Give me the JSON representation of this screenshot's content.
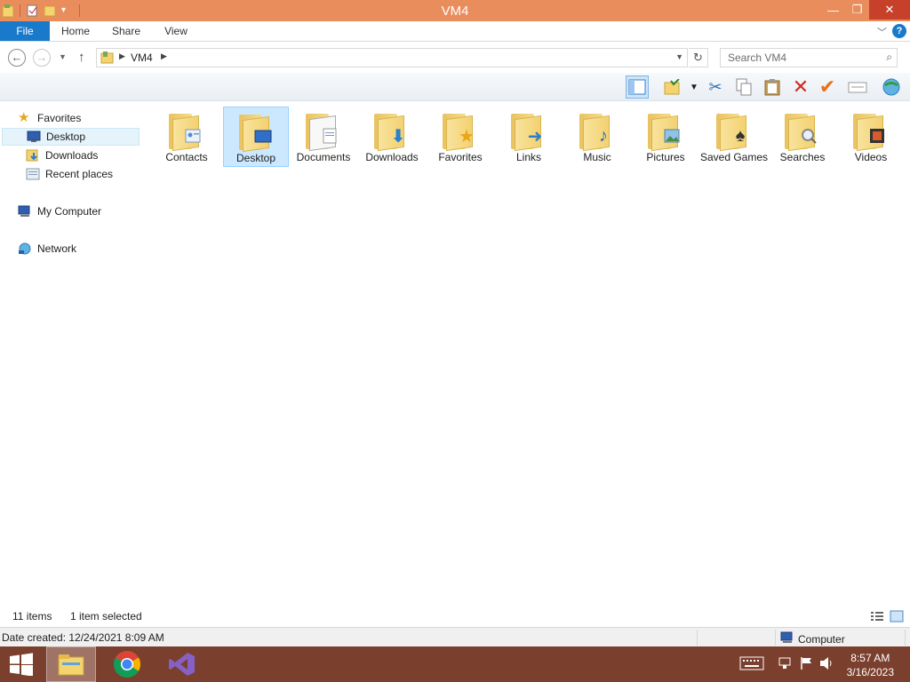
{
  "window": {
    "title": "VM4",
    "minimize": "—",
    "maximize": "❐",
    "close": "✕"
  },
  "ribbon": {
    "tabs": [
      "File",
      "Home",
      "Share",
      "View"
    ],
    "expand_icon": "chevron-down-icon",
    "help": "?"
  },
  "address": {
    "path": "VM4",
    "search_placeholder": "Search VM4"
  },
  "navpane": {
    "favorites": "Favorites",
    "desktop": "Desktop",
    "downloads": "Downloads",
    "recent": "Recent places",
    "computer": "My Computer",
    "network": "Network"
  },
  "folders": [
    {
      "label": "Contacts",
      "icon": "contacts-icon"
    },
    {
      "label": "Desktop",
      "icon": "desktop-icon",
      "selected": true
    },
    {
      "label": "Documents",
      "icon": "documents-icon"
    },
    {
      "label": "Downloads",
      "icon": "downloads-icon"
    },
    {
      "label": "Favorites",
      "icon": "favorites-icon"
    },
    {
      "label": "Links",
      "icon": "links-icon"
    },
    {
      "label": "Music",
      "icon": "music-icon"
    },
    {
      "label": "Pictures",
      "icon": "pictures-icon"
    },
    {
      "label": "Saved Games",
      "icon": "saved-games-icon"
    },
    {
      "label": "Searches",
      "icon": "searches-icon"
    },
    {
      "label": "Videos",
      "icon": "videos-icon"
    }
  ],
  "status": {
    "item_count": "11 items",
    "selected": "1 item selected"
  },
  "details": {
    "date_created": "Date created: 12/24/2021 8:09 AM",
    "zone": "Computer"
  },
  "taskbar": {
    "time": "8:57 AM",
    "date": "3/16/2023"
  },
  "colors": {
    "title_bar": "#e98d5c",
    "file_tab": "#1979ca",
    "taskbar": "#7a3f2d",
    "selection": "#cce8ff"
  }
}
